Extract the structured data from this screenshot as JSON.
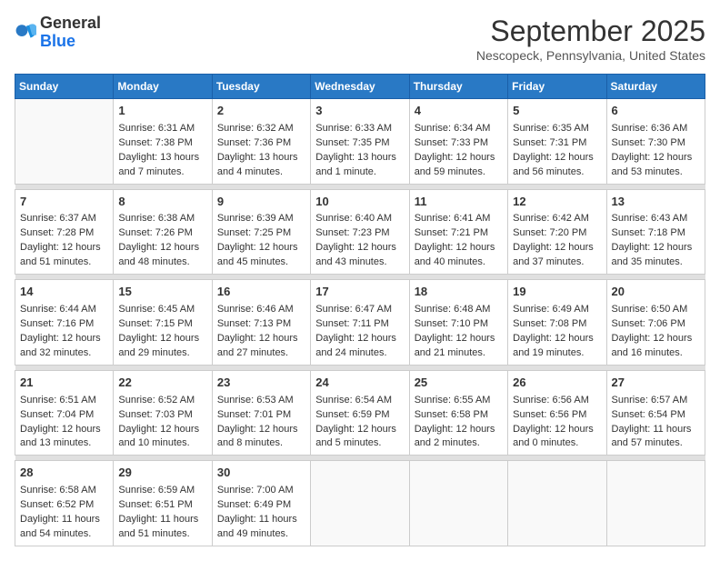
{
  "logo": {
    "line1": "General",
    "line2": "Blue"
  },
  "title": "September 2025",
  "subtitle": "Nescopeck, Pennsylvania, United States",
  "days_of_week": [
    "Sunday",
    "Monday",
    "Tuesday",
    "Wednesday",
    "Thursday",
    "Friday",
    "Saturday"
  ],
  "weeks": [
    [
      {
        "day": "",
        "content": ""
      },
      {
        "day": "1",
        "content": "Sunrise: 6:31 AM\nSunset: 7:38 PM\nDaylight: 13 hours\nand 7 minutes."
      },
      {
        "day": "2",
        "content": "Sunrise: 6:32 AM\nSunset: 7:36 PM\nDaylight: 13 hours\nand 4 minutes."
      },
      {
        "day": "3",
        "content": "Sunrise: 6:33 AM\nSunset: 7:35 PM\nDaylight: 13 hours\nand 1 minute."
      },
      {
        "day": "4",
        "content": "Sunrise: 6:34 AM\nSunset: 7:33 PM\nDaylight: 12 hours\nand 59 minutes."
      },
      {
        "day": "5",
        "content": "Sunrise: 6:35 AM\nSunset: 7:31 PM\nDaylight: 12 hours\nand 56 minutes."
      },
      {
        "day": "6",
        "content": "Sunrise: 6:36 AM\nSunset: 7:30 PM\nDaylight: 12 hours\nand 53 minutes."
      }
    ],
    [
      {
        "day": "7",
        "content": "Sunrise: 6:37 AM\nSunset: 7:28 PM\nDaylight: 12 hours\nand 51 minutes."
      },
      {
        "day": "8",
        "content": "Sunrise: 6:38 AM\nSunset: 7:26 PM\nDaylight: 12 hours\nand 48 minutes."
      },
      {
        "day": "9",
        "content": "Sunrise: 6:39 AM\nSunset: 7:25 PM\nDaylight: 12 hours\nand 45 minutes."
      },
      {
        "day": "10",
        "content": "Sunrise: 6:40 AM\nSunset: 7:23 PM\nDaylight: 12 hours\nand 43 minutes."
      },
      {
        "day": "11",
        "content": "Sunrise: 6:41 AM\nSunset: 7:21 PM\nDaylight: 12 hours\nand 40 minutes."
      },
      {
        "day": "12",
        "content": "Sunrise: 6:42 AM\nSunset: 7:20 PM\nDaylight: 12 hours\nand 37 minutes."
      },
      {
        "day": "13",
        "content": "Sunrise: 6:43 AM\nSunset: 7:18 PM\nDaylight: 12 hours\nand 35 minutes."
      }
    ],
    [
      {
        "day": "14",
        "content": "Sunrise: 6:44 AM\nSunset: 7:16 PM\nDaylight: 12 hours\nand 32 minutes."
      },
      {
        "day": "15",
        "content": "Sunrise: 6:45 AM\nSunset: 7:15 PM\nDaylight: 12 hours\nand 29 minutes."
      },
      {
        "day": "16",
        "content": "Sunrise: 6:46 AM\nSunset: 7:13 PM\nDaylight: 12 hours\nand 27 minutes."
      },
      {
        "day": "17",
        "content": "Sunrise: 6:47 AM\nSunset: 7:11 PM\nDaylight: 12 hours\nand 24 minutes."
      },
      {
        "day": "18",
        "content": "Sunrise: 6:48 AM\nSunset: 7:10 PM\nDaylight: 12 hours\nand 21 minutes."
      },
      {
        "day": "19",
        "content": "Sunrise: 6:49 AM\nSunset: 7:08 PM\nDaylight: 12 hours\nand 19 minutes."
      },
      {
        "day": "20",
        "content": "Sunrise: 6:50 AM\nSunset: 7:06 PM\nDaylight: 12 hours\nand 16 minutes."
      }
    ],
    [
      {
        "day": "21",
        "content": "Sunrise: 6:51 AM\nSunset: 7:04 PM\nDaylight: 12 hours\nand 13 minutes."
      },
      {
        "day": "22",
        "content": "Sunrise: 6:52 AM\nSunset: 7:03 PM\nDaylight: 12 hours\nand 10 minutes."
      },
      {
        "day": "23",
        "content": "Sunrise: 6:53 AM\nSunset: 7:01 PM\nDaylight: 12 hours\nand 8 minutes."
      },
      {
        "day": "24",
        "content": "Sunrise: 6:54 AM\nSunset: 6:59 PM\nDaylight: 12 hours\nand 5 minutes."
      },
      {
        "day": "25",
        "content": "Sunrise: 6:55 AM\nSunset: 6:58 PM\nDaylight: 12 hours\nand 2 minutes."
      },
      {
        "day": "26",
        "content": "Sunrise: 6:56 AM\nSunset: 6:56 PM\nDaylight: 12 hours\nand 0 minutes."
      },
      {
        "day": "27",
        "content": "Sunrise: 6:57 AM\nSunset: 6:54 PM\nDaylight: 11 hours\nand 57 minutes."
      }
    ],
    [
      {
        "day": "28",
        "content": "Sunrise: 6:58 AM\nSunset: 6:52 PM\nDaylight: 11 hours\nand 54 minutes."
      },
      {
        "day": "29",
        "content": "Sunrise: 6:59 AM\nSunset: 6:51 PM\nDaylight: 11 hours\nand 51 minutes."
      },
      {
        "day": "30",
        "content": "Sunrise: 7:00 AM\nSunset: 6:49 PM\nDaylight: 11 hours\nand 49 minutes."
      },
      {
        "day": "",
        "content": ""
      },
      {
        "day": "",
        "content": ""
      },
      {
        "day": "",
        "content": ""
      },
      {
        "day": "",
        "content": ""
      }
    ]
  ]
}
